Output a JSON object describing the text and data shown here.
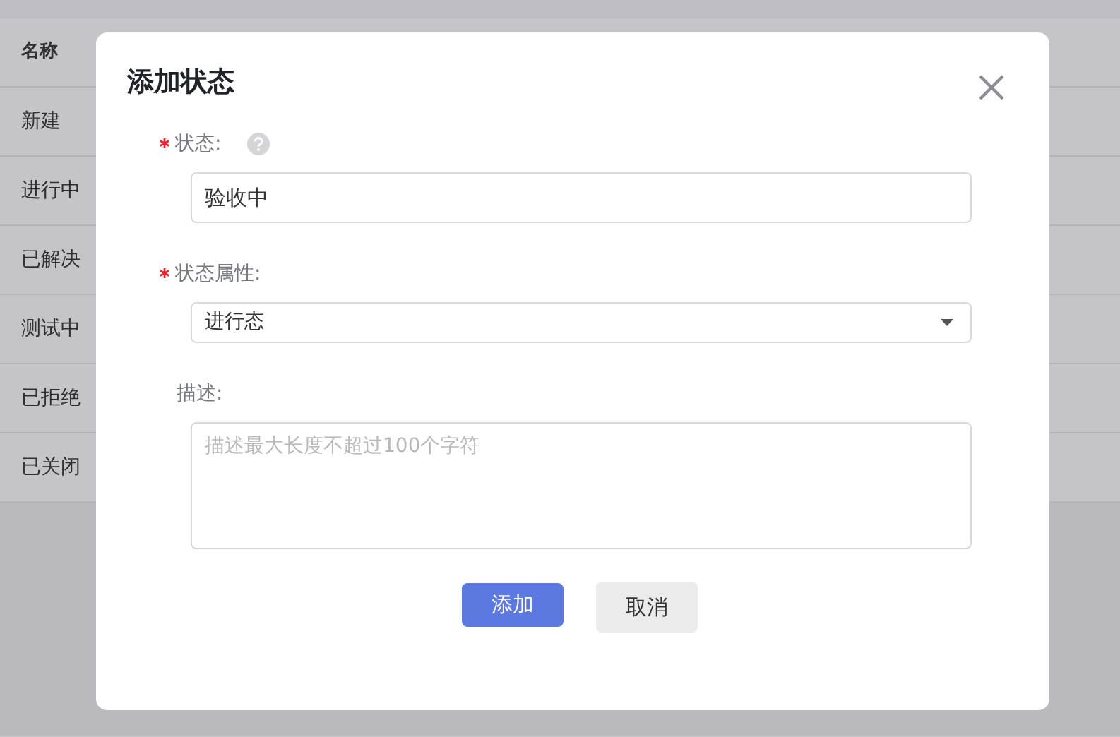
{
  "table": {
    "columns": [
      "名称"
    ],
    "rows": [
      {
        "name": "新建"
      },
      {
        "name": "进行中"
      },
      {
        "name": "已解决"
      },
      {
        "name": "测试中"
      },
      {
        "name": "已拒绝"
      },
      {
        "name": "已关闭"
      }
    ]
  },
  "dialog": {
    "title": "添加状态",
    "fields": [
      {
        "kind": "input",
        "label": "状态:",
        "required": true,
        "help": true,
        "value": "验收中"
      },
      {
        "kind": "select",
        "label": "状态属性:",
        "required": true,
        "help": false,
        "value": "进行态"
      },
      {
        "kind": "textarea",
        "label": "描述:",
        "required": false,
        "help": false,
        "placeholder": "描述最大长度不超过100个字符"
      }
    ],
    "buttons": [
      {
        "label": "添加",
        "kind": "primary"
      },
      {
        "label": "取消",
        "kind": "secondary"
      }
    ]
  }
}
